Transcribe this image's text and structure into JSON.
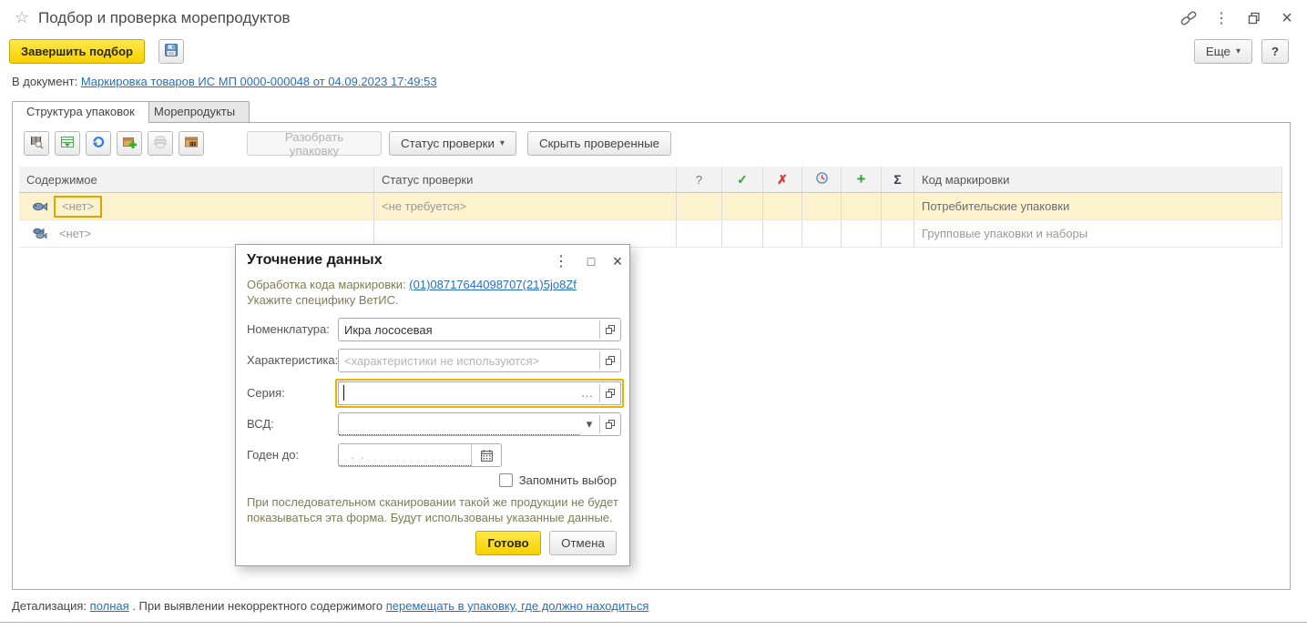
{
  "window": {
    "title": "Подбор и проверка морепродуктов"
  },
  "commandbar": {
    "finish": "Завершить подбор",
    "more": "Еще",
    "help": "?"
  },
  "docline": {
    "label": "В документ:",
    "link": "Маркировка товаров ИС МП 0000-000048 от 04.09.2023 17:49:53"
  },
  "tabs": {
    "structure": "Структура упаковок",
    "seafood": "Морепродукты"
  },
  "toolbar": {
    "disassemble": "Разобрать упаковку",
    "status": "Статус проверки",
    "hide_checked": "Скрыть проверенные"
  },
  "table": {
    "col_content": "Содержимое",
    "col_status": "Статус проверки",
    "col_question": "?",
    "col_check": "✓",
    "col_cross": "✗",
    "col_plus": "+",
    "col_sum": "Σ",
    "col_code": "Код маркировки",
    "rows": [
      {
        "content": "<нет>",
        "status": "<не требуется>",
        "code": "Потребительские упаковки"
      },
      {
        "content": "<нет>",
        "status": "",
        "code": "Групповые упаковки и наборы"
      }
    ]
  },
  "dialog": {
    "title": "Уточнение данных",
    "processing_label": "Обработка кода маркировки:",
    "processing_link": "(01)08717644098707(21)5jo8Zf",
    "instruction": "Укажите специфику ВетИС.",
    "nomenclature_label": "Номенклатура:",
    "nomenclature_value": "Икра лососевая",
    "characteristic_label": "Характеристика:",
    "characteristic_placeholder": "<характеристики не используются>",
    "series_label": "Серия:",
    "vsd_label": "ВСД:",
    "expiry_label": "Годен до:",
    "expiry_placeholder": "  .  .",
    "ellipsis": "...",
    "remember_label": "Запомнить выбор",
    "hint": "При последовательном сканировании такой же продукции не будет показываться эта форма. Будут использованы указанные данные.",
    "done": "Готово",
    "cancel": "Отмена"
  },
  "footer": {
    "label": "Детализация: ",
    "link1": "полная",
    "middle": ". При выявлении некорректного содержимого ",
    "link2": "перемещать в упаковку, где должно находиться"
  },
  "icons": {
    "star": "☆",
    "kebab": "⋮",
    "maximize": "□",
    "close": "×",
    "chevron_down": "▾"
  },
  "colors": {
    "accent_yellow": "#f7d000",
    "link_blue": "#2470c0",
    "error_red": "#dd1111",
    "hint_olive": "#7d7d54",
    "row_highlight": "#fcf2cd",
    "focus_orange": "#eab200"
  }
}
